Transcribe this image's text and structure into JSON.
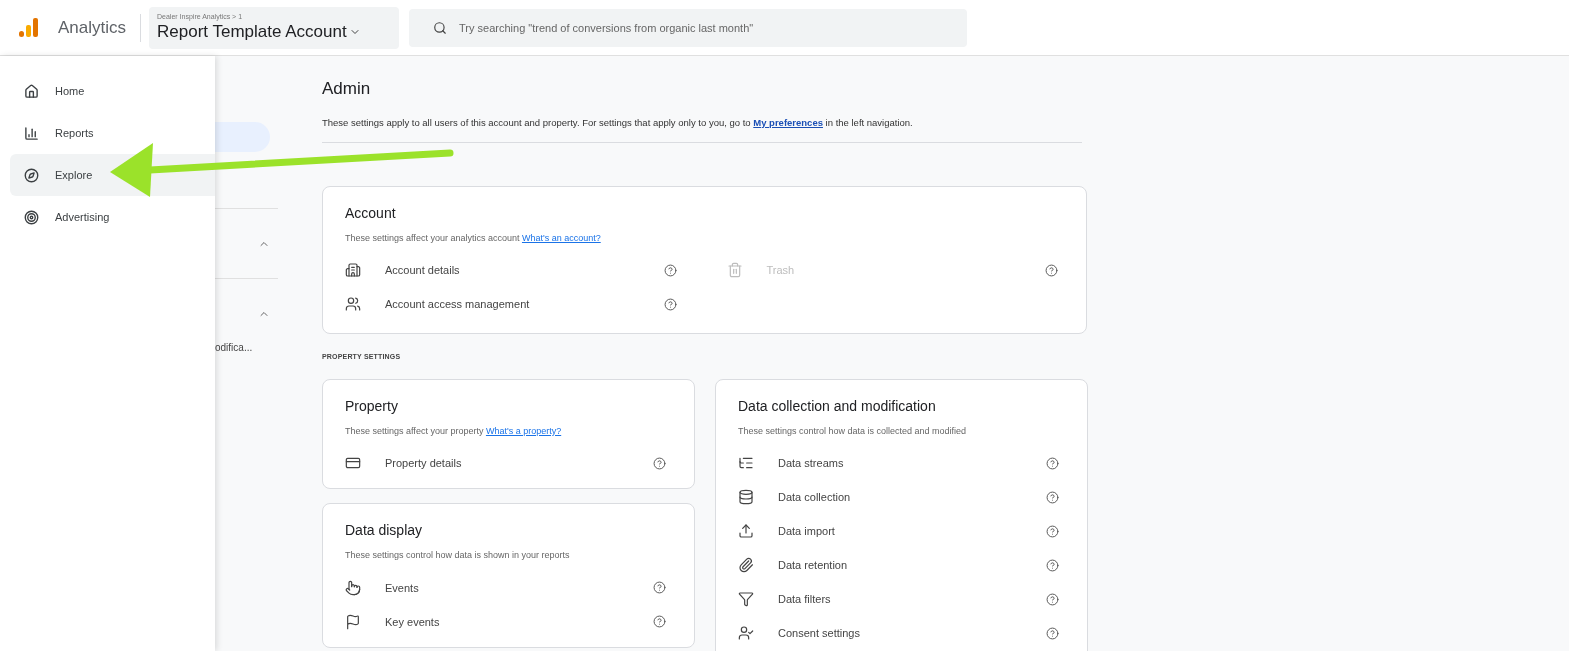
{
  "header": {
    "app_name": "Analytics",
    "breadcrumb": "Dealer Inspire Analytics > 1",
    "account": "Report Template Account",
    "search": {
      "placeholder": "Try searching \"trend of conversions from organic last month\""
    }
  },
  "nav": {
    "items": [
      {
        "label": "Home",
        "selected": false
      },
      {
        "label": "Reports",
        "selected": false
      },
      {
        "label": "Explore",
        "selected": true
      },
      {
        "label": "Advertising",
        "selected": false
      }
    ]
  },
  "sidebar": {
    "sections": [
      {
        "expanded": true
      },
      {
        "expanded": true
      }
    ],
    "cut_item": "odifica..."
  },
  "page": {
    "title": "Admin",
    "description": "These settings apply to all users of this account and property. For settings that apply only to you, go to",
    "link": "My preferences",
    "description_end": "in the left navigation."
  },
  "account_card": {
    "title": "Account",
    "description": "These settings affect your analytics account",
    "link": "What's an account?",
    "items": [
      {
        "label": "Account details",
        "disabled": false
      },
      {
        "label": "Trash",
        "disabled": true
      },
      {
        "label": "Account access management",
        "disabled": false
      }
    ]
  },
  "property_settings_label": "PROPERTY SETTINGS",
  "cards": [
    {
      "title": "Property",
      "description": "These settings affect your property",
      "link": "What's a property?",
      "items": [
        {
          "label": "Property details",
          "disabled": false
        }
      ]
    },
    {
      "title": "Data display",
      "description": "These settings control how data is shown in your reports",
      "items": [
        {
          "label": "Events",
          "disabled": false
        },
        {
          "label": "Key events",
          "disabled": false
        }
      ]
    },
    {
      "title": "Data collection and modification",
      "description": "These settings control how data is collected and modified",
      "items": [
        {
          "label": "Data streams",
          "disabled": false
        },
        {
          "label": "Data collection",
          "disabled": false
        },
        {
          "label": "Data import",
          "disabled": false
        },
        {
          "label": "Data retention",
          "disabled": false
        },
        {
          "label": "Data filters",
          "disabled": false
        },
        {
          "label": "Consent settings",
          "disabled": false
        }
      ]
    }
  ]
}
